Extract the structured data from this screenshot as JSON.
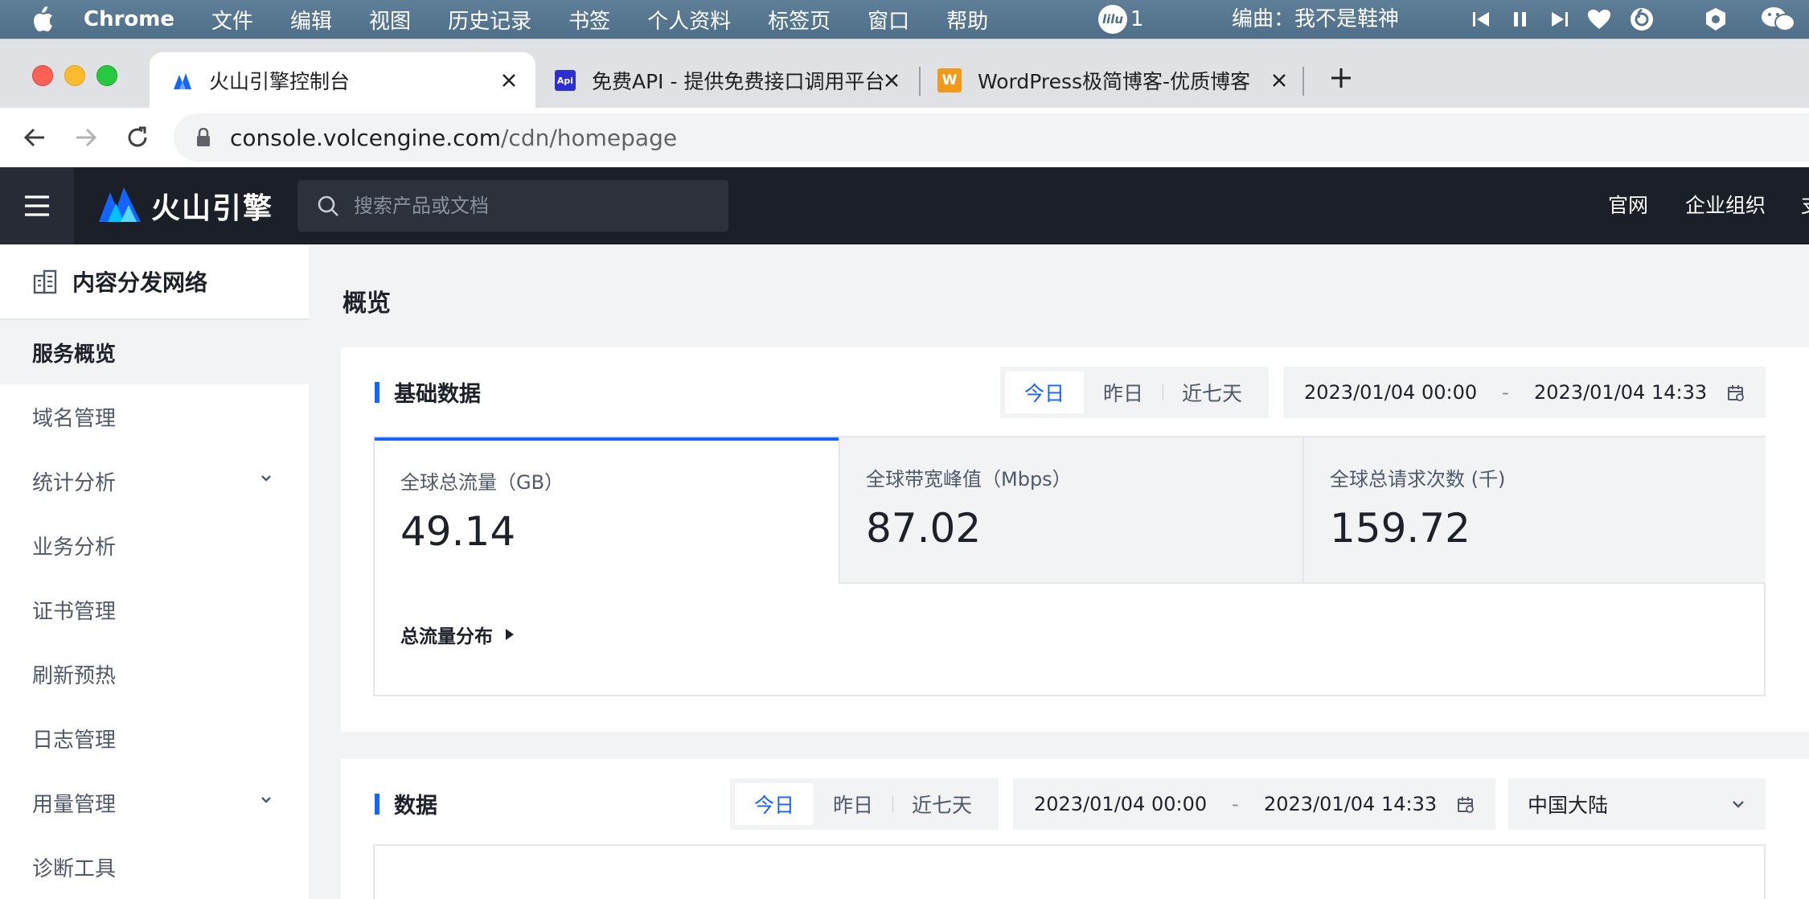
{
  "menubar": {
    "app_name": "Chrome",
    "items": [
      "文件",
      "编辑",
      "视图",
      "历史记录",
      "书签",
      "个人资料",
      "标签页",
      "窗口",
      "帮助"
    ],
    "badge_icon_text": "lilu",
    "badge_count": "1",
    "now_playing": "编曲：我不是鞋神"
  },
  "browser": {
    "tabs": [
      {
        "title": "火山引擎控制台",
        "favicon": "volcengine-logo"
      },
      {
        "title": "免费API - 提供免费接口调用平台",
        "favicon": "api-logo",
        "favicon_text": "Api"
      },
      {
        "title": "WordPress极简博客-优质博客",
        "favicon": "w-logo",
        "favicon_text": "W"
      }
    ],
    "url_host": "console.volcengine.com",
    "url_path": "/cdn/homepage"
  },
  "header": {
    "logo_text": "火山引擎",
    "search_placeholder": "搜索产品或文档",
    "links": [
      "官网",
      "企业组织",
      "支"
    ]
  },
  "sidebar": {
    "title": "内容分发网络",
    "items": [
      {
        "label": "服务概览",
        "active": true
      },
      {
        "label": "域名管理"
      },
      {
        "label": "统计分析",
        "expandable": true
      },
      {
        "label": "业务分析"
      },
      {
        "label": "证书管理"
      },
      {
        "label": "刷新预热"
      },
      {
        "label": "日志管理"
      },
      {
        "label": "用量管理",
        "expandable": true
      },
      {
        "label": "诊断工具"
      }
    ]
  },
  "main": {
    "page_title": "概览",
    "basic": {
      "title": "基础数据",
      "periods": [
        "今日",
        "昨日",
        "近七天"
      ],
      "selected_period": "今日",
      "date_start": "2023/01/04 00:00",
      "date_sep": "-",
      "date_end": "2023/01/04 14:33",
      "metrics": [
        {
          "label": "全球总流量（GB）",
          "value": "49.14"
        },
        {
          "label": "全球带宽峰值（Mbps）",
          "value": "87.02"
        },
        {
          "label": "全球总请求次数 (千)",
          "value": "159.72"
        }
      ],
      "distribution_label": "总流量分布"
    },
    "data": {
      "title": "数据",
      "periods": [
        "今日",
        "昨日",
        "近七天"
      ],
      "date_start": "2023/01/04 00:00",
      "date_sep": "-",
      "date_end": "2023/01/04 14:33",
      "region": "中国大陆"
    }
  },
  "colors": {
    "accent": "#1664ff",
    "header_bg": "#1b1f27",
    "menubar_bg": "#55748e"
  }
}
